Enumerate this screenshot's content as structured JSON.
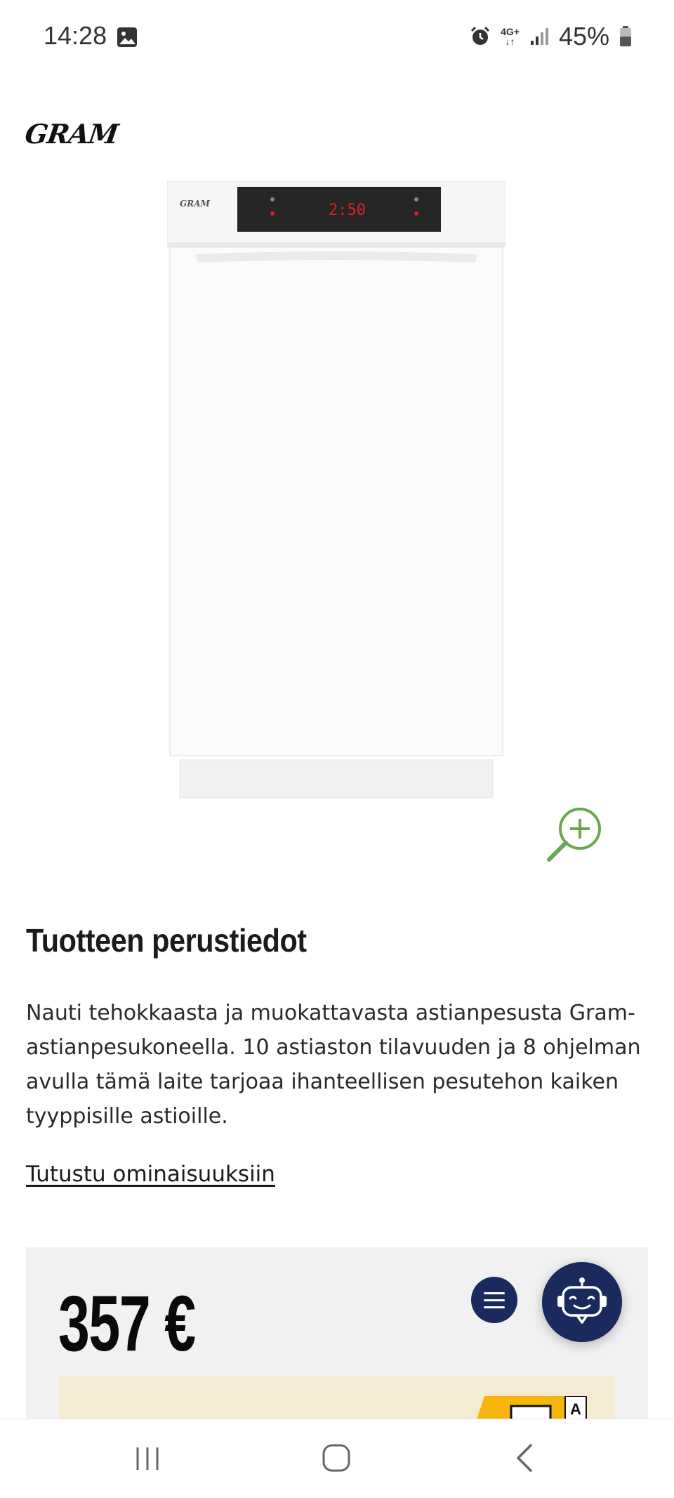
{
  "status_bar": {
    "time": "14:28",
    "network": "4G+",
    "battery": "45%",
    "icons": [
      "gallery-icon",
      "alarm-icon",
      "network-4g-icon",
      "signal-icon",
      "battery-icon"
    ]
  },
  "brand": {
    "logo_text": "GRAM"
  },
  "product": {
    "image_icon": "dishwasher-image",
    "display_readout": "2:50",
    "zoom_icon": "zoom-in-icon"
  },
  "info": {
    "title": "Tuotteen perustiedot",
    "description": "Nauti tehokkaasta ja muokattavasta astianpesusta Gram-astianpesukoneella. 10 astiaston tilavuuden ja 8 ohjelman avulla tämä laite tarjoaa ihanteellisen pesutehon kaiken tyyppisille astioille.",
    "features_link": "Tutustu ominaisuuksiin"
  },
  "price_card": {
    "price": "357 €",
    "menu_icon": "menu-icon",
    "energy_class": "A",
    "colors": {
      "card_bg": "#f1f1f1",
      "energy_bg": "#f4ebd2",
      "button": "#1a2a5c"
    }
  },
  "chat": {
    "icon": "chatbot-icon"
  },
  "nav_bar": {
    "icons": [
      "recents-icon",
      "home-icon",
      "back-icon"
    ]
  },
  "colors": {
    "accent_green": "#6aa84f",
    "navy": "#1a2a5c"
  }
}
